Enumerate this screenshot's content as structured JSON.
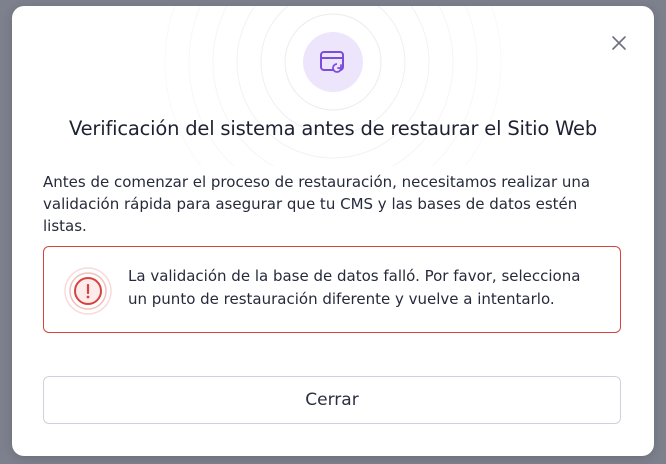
{
  "dialog": {
    "title": "Verificación del sistema antes de restaurar el Sitio Web",
    "description": "Antes de comenzar el proceso de restauración, necesitamos realizar una validación rápida para asegurar que tu CMS y las bases de datos estén listas.",
    "alert": {
      "message": "La validación de la base de datos falló. Por favor, selecciona un punto de restauración diferente y vuelve a intentarlo.",
      "icon": "alert-circle-icon",
      "color": "#d7443e"
    },
    "hero_icon": "browser-restore-icon",
    "close_icon": "close-icon",
    "close_button_label": "Cerrar",
    "accent": "#7c4ddb"
  }
}
